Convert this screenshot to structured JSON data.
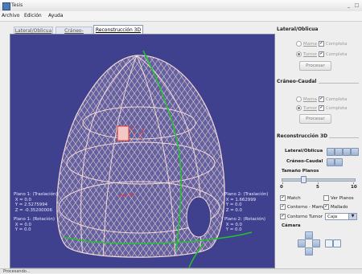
{
  "window": {
    "title": "Tesis"
  },
  "menu": [
    "Archivo",
    "Edición",
    "Ayuda"
  ],
  "tabs": [
    {
      "label": "Lateral/Oblicua",
      "active": false
    },
    {
      "label": "Cráneo-Caudal",
      "active": false
    },
    {
      "label": "Reconstrucción 3D",
      "active": true
    }
  ],
  "viewport": {
    "plane1_translation": "Plano 1: (Traslación)\n X = 0.0\n Y = 2.5275994\n Z = -0.35200006",
    "plane1_rotation": "Plano 1: (Rotación)\n X = 0.0\n Y = 0.0",
    "plane2_translation": "Plano 2: (Traslación)\n X = 1.662999\n Y = 0.0\n Z = 0.0",
    "plane2_rotation": "Plano 2: (Rotación)\n X = 0.0\n Y = 0.0",
    "colors": {
      "background": "#3f418e",
      "mesh": "#f4d9d7",
      "plane_line": "#22c22a",
      "marker": "#e8342c"
    }
  },
  "panel_lateral": {
    "title": "Lateral/Oblicua",
    "mama_label": "Mama",
    "tumor_label": "Tumor",
    "completa_label": "Completa",
    "process_label": "Procesar"
  },
  "panel_craneo": {
    "title": "Cráneo-Caudal",
    "mama_label": "Mama",
    "tumor_label": "Tumor",
    "completa_label": "Completa",
    "process_label": "Procesar"
  },
  "panel_3d": {
    "title": "Reconstrucción 3D",
    "lateral_label": "Lateral/Oblicua",
    "craneo_label": "Cráneo-Caudal",
    "size_label": "Tamaño Planos",
    "slider_min": "0",
    "slider_mid": "5",
    "slider_max": "10",
    "slider_value": 3,
    "match_label": "Match",
    "ver_planos_label": "Ver Planos",
    "contorno_mama_label": "Contorno - Mama",
    "mallado_label": "Mallado",
    "contorno_tumor_label": "Contorno Tumor",
    "mesh_select_value": "Caja",
    "camera_label": "Cámara"
  },
  "status": {
    "text": "Procesando..."
  }
}
